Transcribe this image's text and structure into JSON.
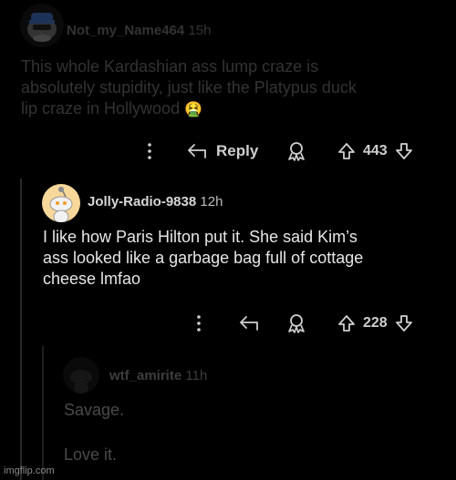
{
  "comments": [
    {
      "username": "Not_my_Name464",
      "time": "15h",
      "body_lines": [
        "This whole Kardashian ass lump craze is",
        "absolutely stupidity, just like the Platypus duck",
        "lip craze in Hollywood"
      ],
      "emoji": "🤮",
      "reply_label": "Reply",
      "score": "443"
    },
    {
      "username": "Jolly-Radio-9838",
      "time": "12h",
      "body_lines": [
        "I like how Paris Hilton put it. She said Kim’s",
        "ass looked like a garbage bag full of cottage",
        "cheese lmfao"
      ],
      "score": "228"
    },
    {
      "username": "wtf_amirite",
      "time": "11h",
      "body_lines": [
        "Savage.",
        "",
        "Love it."
      ]
    }
  ],
  "watermark": "imgflip.com",
  "colors": {
    "background": "#000000",
    "comment1_text": "#333333",
    "comment2_text": "#e6e6e6",
    "comment3_text": "#4a4a4a",
    "thread_line": "#2a2a2a",
    "avatar2_bg": "#f7d79a"
  }
}
